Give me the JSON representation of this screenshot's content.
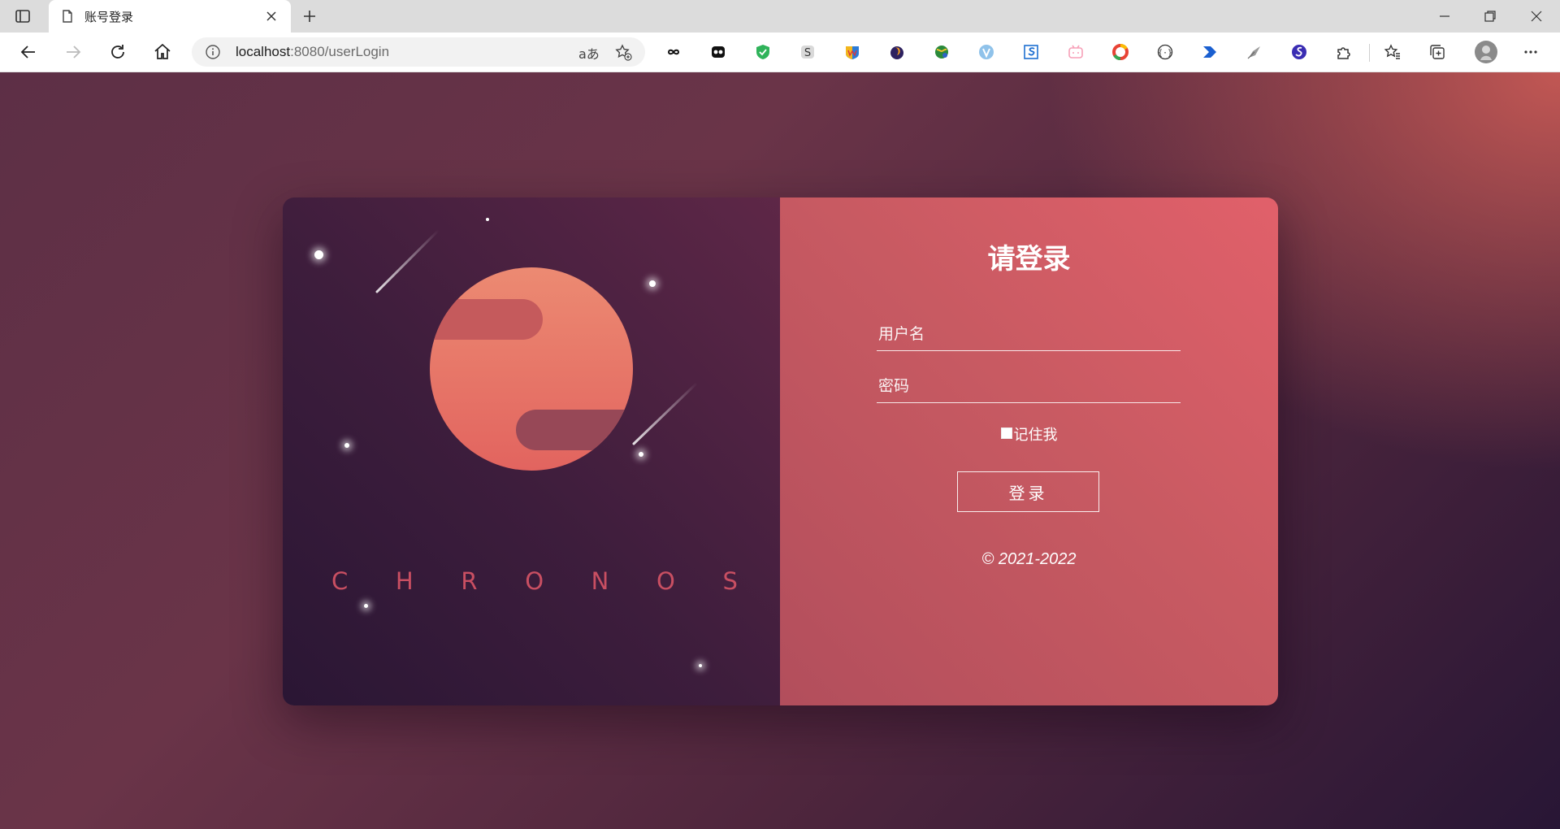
{
  "browser": {
    "tab_title": "账号登录",
    "url_host": "localhost",
    "url_rest": ":8080/userLogin",
    "read_aloud": "aあ",
    "extensions": [
      "infinity-icon",
      "ghost-icon",
      "shield-icon",
      "s-extension-icon",
      "w-extension-icon",
      "flame-extension-icon",
      "globe-extension-icon",
      "v-extension-icon",
      "s-square-extension-icon",
      "bilibili-icon",
      "chrome-ring-icon",
      "braces-icon",
      "arrow-extension-icon",
      "quill-icon",
      "s-purple-icon",
      "puzzle-icon"
    ]
  },
  "brand": {
    "letters": [
      "C",
      "H",
      "R",
      "O",
      "N",
      "O",
      "S"
    ],
    "color": "#c94f62"
  },
  "login": {
    "title": "请登录",
    "username_placeholder": "用户名",
    "password_placeholder": "密码",
    "remember_label": "记住我",
    "submit_label": "登录",
    "copyright": "© 2021-2022"
  },
  "colors": {
    "planet": "#e8706a",
    "card_right": "#c85a62",
    "card_left": "#3d1d3c"
  }
}
